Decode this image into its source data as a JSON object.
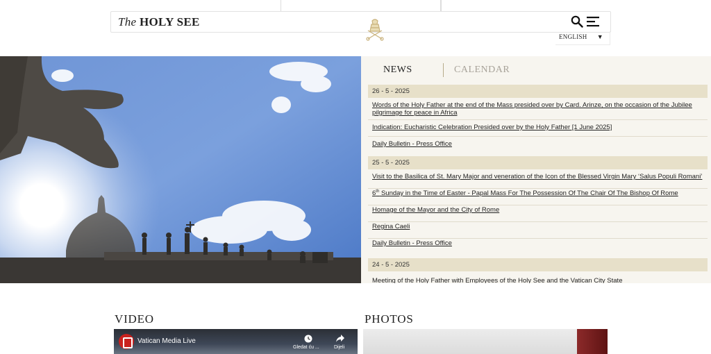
{
  "header": {
    "logo_prefix": "The",
    "logo_name": "HOLY SEE",
    "language": "ENGLISH",
    "language_caret": "▼"
  },
  "tabs": {
    "news": "NEWS",
    "calendar": "CALENDAR"
  },
  "news": {
    "groups": [
      {
        "date": "26 - 5 - 2025",
        "items": [
          "Words of the Holy Father at the end of the Mass presided over by Card. Arinze, on the occasion of the Jubilee pilgrimage for peace in Africa",
          "Indication: Eucharistic Celebration Presided over by the Holy Father [1 June 2025]",
          "Daily Bulletin - Press Office"
        ]
      },
      {
        "date": "25 - 5 - 2025",
        "items": [
          "Visit to the Basilica of St. Mary Major and veneration of the Icon of the Blessed Virgin Mary ‘Salus Populi Romani’",
          "6",
          "Homage of the Mayor and the City of Rome",
          "Regina Caeli",
          "Daily Bulletin - Press Office"
        ]
      },
      {
        "date": "24 - 5 - 2025",
        "items": [
          "Meeting of the Holy Father with Employees of the Holy See and the Vatican City State"
        ]
      }
    ],
    "sunday_mass": {
      "num": "6",
      "sup": "th",
      "rest": " Sunday in the Time of Easter - Papal Mass For The Possession Of The Chair Of The Bishop Of Rome"
    }
  },
  "sections": {
    "video": "VIDEO",
    "photos": "PHOTOS"
  },
  "video": {
    "channel": "Vatican Media Live",
    "watch_later": "Gledat ću ...",
    "share": "Dijeli"
  },
  "colors": {
    "panel_bg": "#f7f5ef",
    "date_bg": "#e7e0c9",
    "tab_inactive": "#a8a39a",
    "gold": "#c9b27c"
  }
}
